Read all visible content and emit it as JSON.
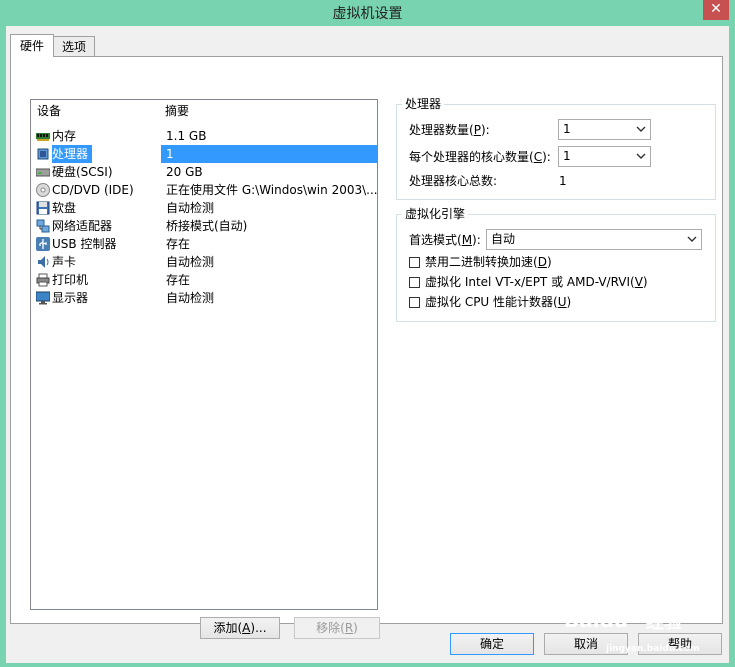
{
  "window": {
    "title": "虚拟机设置",
    "close_glyph": "✕"
  },
  "tabs": [
    {
      "label": "硬件"
    },
    {
      "label": "选项"
    }
  ],
  "device_list": {
    "columns": {
      "device": "设备",
      "summary": "摘要"
    },
    "items": [
      {
        "name": "内存",
        "summary": "1.1 GB",
        "icon": "memory-icon",
        "selected": false
      },
      {
        "name": "处理器",
        "summary": "1",
        "icon": "processor-icon",
        "selected": true
      },
      {
        "name": "硬盘(SCSI)",
        "summary": "20 GB",
        "icon": "hard-disk-icon",
        "selected": false
      },
      {
        "name": "CD/DVD (IDE)",
        "summary": "正在使用文件 G:\\Windos\\win 2003\\...",
        "icon": "cd-dvd-icon",
        "selected": false
      },
      {
        "name": "软盘",
        "summary": "自动检测",
        "icon": "floppy-icon",
        "selected": false
      },
      {
        "name": "网络适配器",
        "summary": "桥接模式(自动)",
        "icon": "network-adapter-icon",
        "selected": false
      },
      {
        "name": "USB 控制器",
        "summary": "存在",
        "icon": "usb-icon",
        "selected": false
      },
      {
        "name": "声卡",
        "summary": "自动检测",
        "icon": "sound-card-icon",
        "selected": false
      },
      {
        "name": "打印机",
        "summary": "存在",
        "icon": "printer-icon",
        "selected": false
      },
      {
        "name": "显示器",
        "summary": "自动检测",
        "icon": "display-icon",
        "selected": false
      }
    ],
    "add_button": {
      "text": "添加(",
      "key": "A",
      "tail": ")..."
    },
    "remove_button": {
      "text": "移除(",
      "key": "R",
      "tail": ")"
    }
  },
  "processor_group": {
    "title": "处理器",
    "count_label": {
      "text": "处理器数量(",
      "key": "P",
      "tail": "):"
    },
    "count_value": "1",
    "cores_label": {
      "text": "每个处理器的核心数量(",
      "key": "C",
      "tail": "):"
    },
    "cores_value": "1",
    "total_label": "处理器核心总数:",
    "total_value": "1"
  },
  "virt_group": {
    "title": "虚拟化引擎",
    "mode_label": {
      "text": "首选模式(",
      "key": "M",
      "tail": "):"
    },
    "mode_value": "自动",
    "options": [
      {
        "text": "禁用二进制转换加速(",
        "key": "D",
        "tail": ")",
        "checked": false
      },
      {
        "text": "虚拟化 Intel VT-x/EPT 或 AMD-V/RVI(",
        "key": "V",
        "tail": ")",
        "checked": false
      },
      {
        "text": "虚拟化 CPU 性能计数器(",
        "key": "U",
        "tail": ")",
        "checked": false
      }
    ]
  },
  "footer": {
    "ok": "确定",
    "cancel": "取消",
    "help": "帮助"
  },
  "watermark": {
    "brand": "Baidu",
    "sub": "经验",
    "url": "jingyan.baidu.com"
  }
}
